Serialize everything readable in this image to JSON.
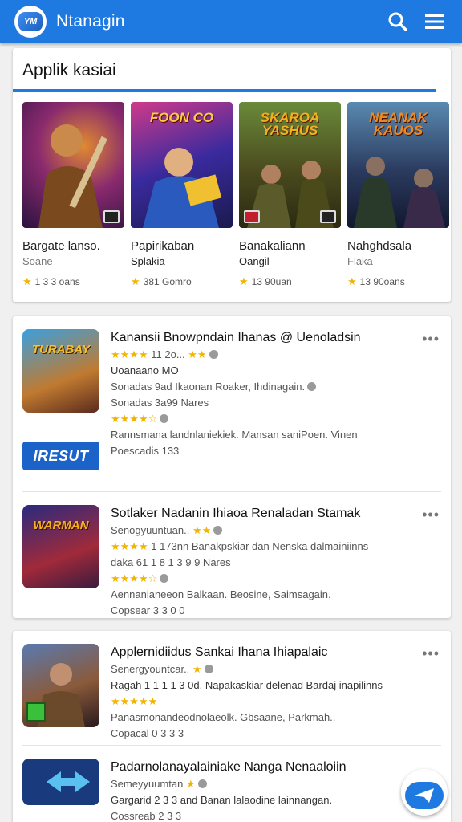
{
  "header": {
    "logo_text": "YM",
    "title": "Ntanagin",
    "search_icon": "search-icon",
    "menu_icon": "hamburger-menu-icon"
  },
  "featured": {
    "section_title": "Applik kasiai",
    "items": [
      {
        "name": "Bargate lanso.",
        "sub": "Soane",
        "rating": "1 3 3 oans",
        "art_text": "",
        "colors": [
          "#3a1a5e",
          "#c0501a"
        ]
      },
      {
        "name": "Papirikaban",
        "sub": "Splakia",
        "rating": "381 Gomro",
        "art_text": "FOON CO",
        "colors": [
          "#1a2a6e",
          "#e0b020"
        ]
      },
      {
        "name": "Banakaliann",
        "sub": "Oangil",
        "rating": "13 90uan",
        "art_text": "SKAROA YASHUS",
        "colors": [
          "#2e3a1a",
          "#b07a2a"
        ]
      },
      {
        "name": "Nahghdsala",
        "sub": "Flaka",
        "rating": "13 90oans",
        "art_text": "NEANAK KAUOS",
        "colors": [
          "#1a2a3e",
          "#4a6a8e"
        ]
      }
    ]
  },
  "list_items": [
    {
      "title": "Kanansii Bnowpndain Ihanas @ Uenoladsin",
      "line1": "11 2o...",
      "line2": "Uoanaano MO",
      "line3": "Roaker, Ihdinagain.",
      "line3_prefix": "Sonadas 9ad Ikaonan",
      "line4": "Sonadas 3a99 Nares",
      "line5": "Rannsmana landnlaniekiek. Mansan saniPoen. Vinen",
      "line6": "Poescadis 133",
      "thumb_text": "TURABAY",
      "result_label": "IRESUT"
    },
    {
      "title": "Sotlaker Nadanin Ihiaoa Renaladan Stamak",
      "line1": "Senogyuuntuan..",
      "line2": "1 173nn Banakpskiar dan Nenska dalmainiinns",
      "line3": "daka 61 1 8 1 3 9 9 Nares",
      "line4": "Aennanianeeon Balkaan. Beosine, Saimsagain.",
      "line5": "Copsear 3 3 0 0",
      "thumb_text": "WARMAN"
    },
    {
      "title": "Applernidiidus Sankai Ihana Ihiapalaic",
      "line1": "Senergyountcar..",
      "line2": "Ragah 1 1 1 1 3 0d. Napakaskiar delenad Bardaj inapilinns",
      "line3": "Panasmonandeodnolaeolk. Gbsaane, Parkmah..",
      "line4": "Copacal 0 3 3 3"
    },
    {
      "title": "Padarnolanayalainiake Nanga Nenaaloiin",
      "line1": "Semeyyuumtan",
      "line2": "Gargarid 2 3 3 and Banan lalaodine lainnangan.",
      "line3": "Cossreab 2 3 3"
    }
  ],
  "fab": {
    "icon": "chat-send-icon"
  }
}
